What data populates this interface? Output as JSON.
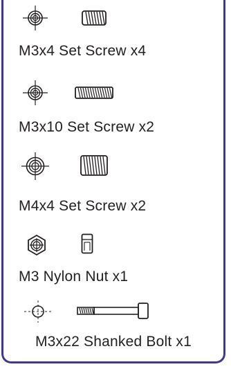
{
  "parts": [
    {
      "label": "M3x4 Set Screw x4",
      "symbol": "washer-crosshair-icon",
      "drawing": "short-set-screw-icon"
    },
    {
      "label": "M3x10 Set Screw x2",
      "symbol": "washer-crosshair-icon",
      "drawing": "long-set-screw-icon"
    },
    {
      "label": "M4x4 Set Screw x2",
      "symbol": "washer-crosshair-icon",
      "drawing": "wide-set-screw-icon"
    },
    {
      "label": "M3 Nylon Nut x1",
      "symbol": "hex-nut-icon",
      "drawing": "nylon-nut-side-icon"
    },
    {
      "label": "M3x22 Shanked Bolt x1",
      "symbol": "bolt-head-crosshair-icon",
      "drawing": "shanked-bolt-icon"
    }
  ],
  "colors": {
    "border": "#3d3a8c",
    "ink": "#231f20"
  }
}
